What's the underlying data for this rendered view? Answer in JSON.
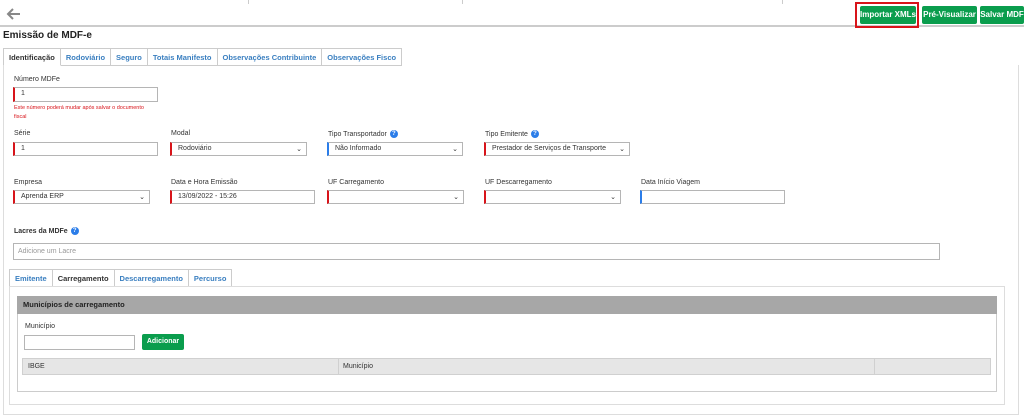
{
  "toolbar": {
    "import_label": "Importar XMLs",
    "preview_label": "Pré-Visualizar",
    "save_label": "Salvar MDF"
  },
  "page_title": "Emissão de MDF-e",
  "tabs": [
    "Identificação",
    "Rodoviário",
    "Seguro",
    "Totais Manifesto",
    "Observações Contribuinte",
    "Observações Fisco"
  ],
  "form": {
    "numero": {
      "label": "Número MDFe",
      "value": "1",
      "hint_line1": "Este número poderá mudar após salvar o documento",
      "hint_line2": "fiscal"
    },
    "serie": {
      "label": "Série",
      "value": "1"
    },
    "modal": {
      "label": "Modal",
      "value": "Rodoviário"
    },
    "tipo_transportador": {
      "label": "Tipo Transportador",
      "value": "Não Informado"
    },
    "tipo_emitente": {
      "label": "Tipo Emitente",
      "value": "Prestador de Serviços de Transporte"
    },
    "empresa": {
      "label": "Empresa",
      "value": "Aprenda ERP"
    },
    "data_emissao": {
      "label": "Data e Hora Emissão",
      "value": "13/09/2022 - 15:26"
    },
    "uf_carregamento": {
      "label": "UF Carregamento",
      "value": ""
    },
    "uf_descarregamento": {
      "label": "UF Descarregamento",
      "value": ""
    },
    "data_inicio": {
      "label": "Data Início Viagem",
      "value": ""
    }
  },
  "lacres": {
    "label": "Lacres da MDFe",
    "placeholder": "Adicione um Lacre"
  },
  "subtabs": [
    "Emitente",
    "Carregamento",
    "Descarregamento",
    "Percurso"
  ],
  "municipios": {
    "header": "Municípios de carregamento",
    "field_label": "Município",
    "add_label": "Adicionar",
    "columns": [
      "IBGE",
      "Município"
    ]
  },
  "colors": {
    "accent_green": "#0a9d4d",
    "required_red": "#d8141a",
    "link_blue": "#3a7fc0"
  }
}
